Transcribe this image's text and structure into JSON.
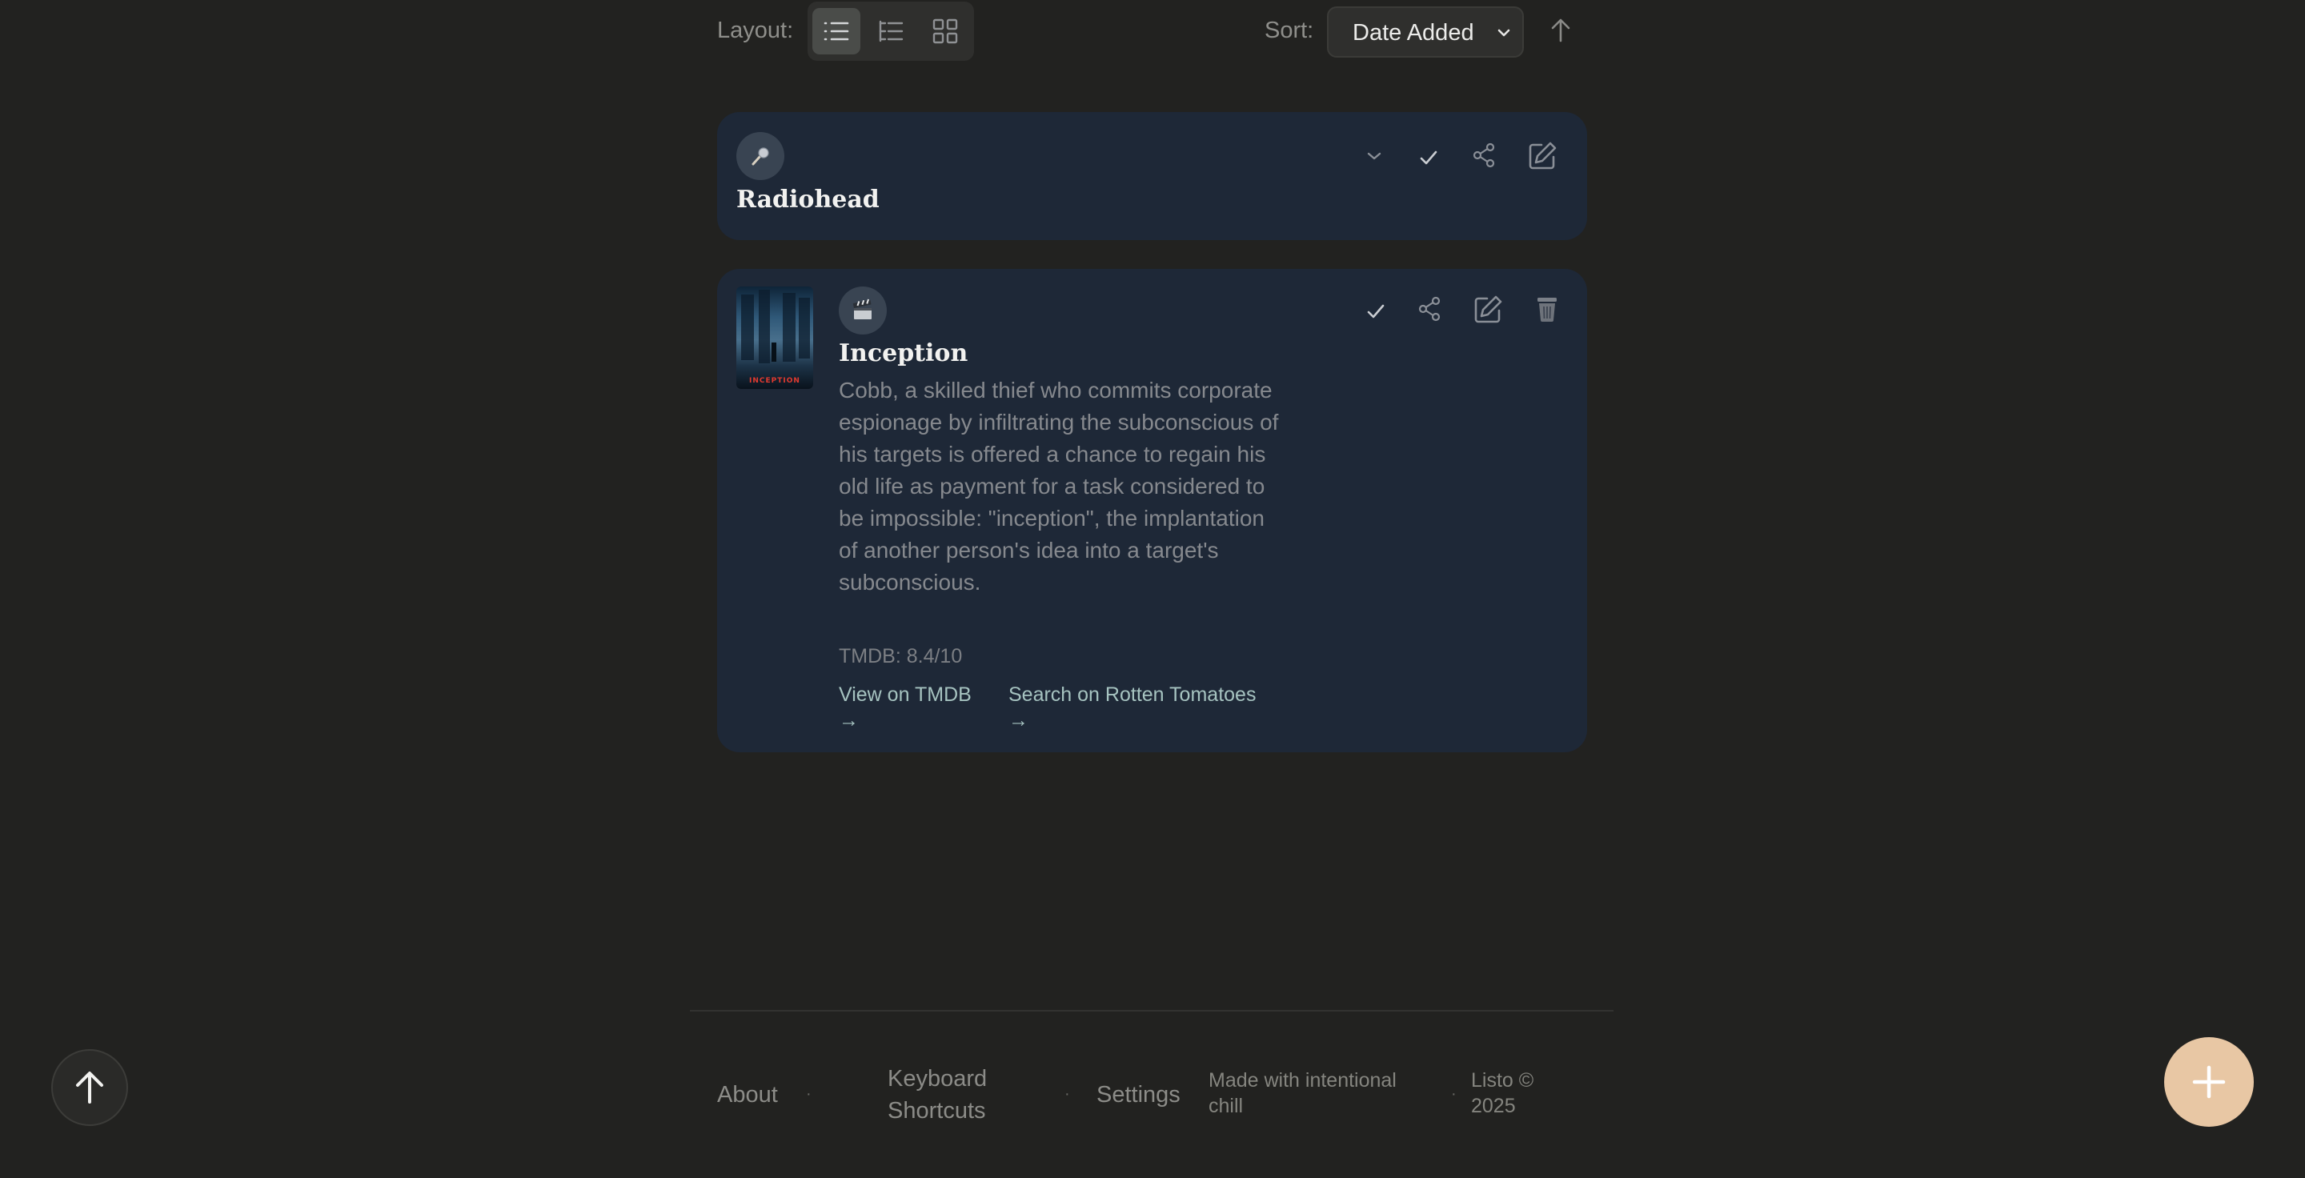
{
  "toolbar": {
    "layout_label": "Layout:",
    "layout_options": [
      {
        "name": "list",
        "icon": "list-icon",
        "active": true
      },
      {
        "name": "compact",
        "icon": "compact-list-icon",
        "active": false
      },
      {
        "name": "grid",
        "icon": "grid-icon",
        "active": false
      }
    ],
    "sort_label": "Sort:",
    "sort_value": "Date Added",
    "sort_direction_icon": "arrow-up-icon"
  },
  "items": [
    {
      "type": "artist",
      "type_icon": "microphone-icon",
      "title": "Radiohead",
      "actions": [
        "expand",
        "mark-done",
        "share",
        "edit"
      ]
    },
    {
      "type": "movie",
      "type_icon": "clapperboard-icon",
      "title": "Inception",
      "poster_text": "INCEPTION",
      "description": "Cobb, a skilled thief who commits corporate espionage by infiltrating the subconscious of his targets is offered a chance to regain his old life as payment for a task considered to be impossible: \"inception\", the implantation of another person's idea into a target's subconscious.",
      "rating": "TMDB: 8.4/10",
      "links": [
        {
          "label": "View on TMDB",
          "arrow": "→"
        },
        {
          "label": "Search on Rotten Tomatoes",
          "arrow": "→"
        }
      ],
      "actions": [
        "mark-done",
        "share",
        "edit",
        "delete"
      ]
    }
  ],
  "footer": {
    "about": "About",
    "keyboard_shortcuts_line1": "Keyboard",
    "keyboard_shortcuts_line2": "Shortcuts",
    "settings": "Settings",
    "made_with_line1": "Made with intentional",
    "made_with_line2": "chill",
    "copyright_line1": "Listo ©",
    "copyright_line2": "2025",
    "separator": "·"
  },
  "floating": {
    "scroll_top_icon": "arrow-up-icon",
    "add_icon": "plus-icon"
  },
  "colors": {
    "background": "#222220",
    "card": "#1e2837",
    "accent_fab": "#e8c7a4",
    "link": "#a6c3c0"
  }
}
